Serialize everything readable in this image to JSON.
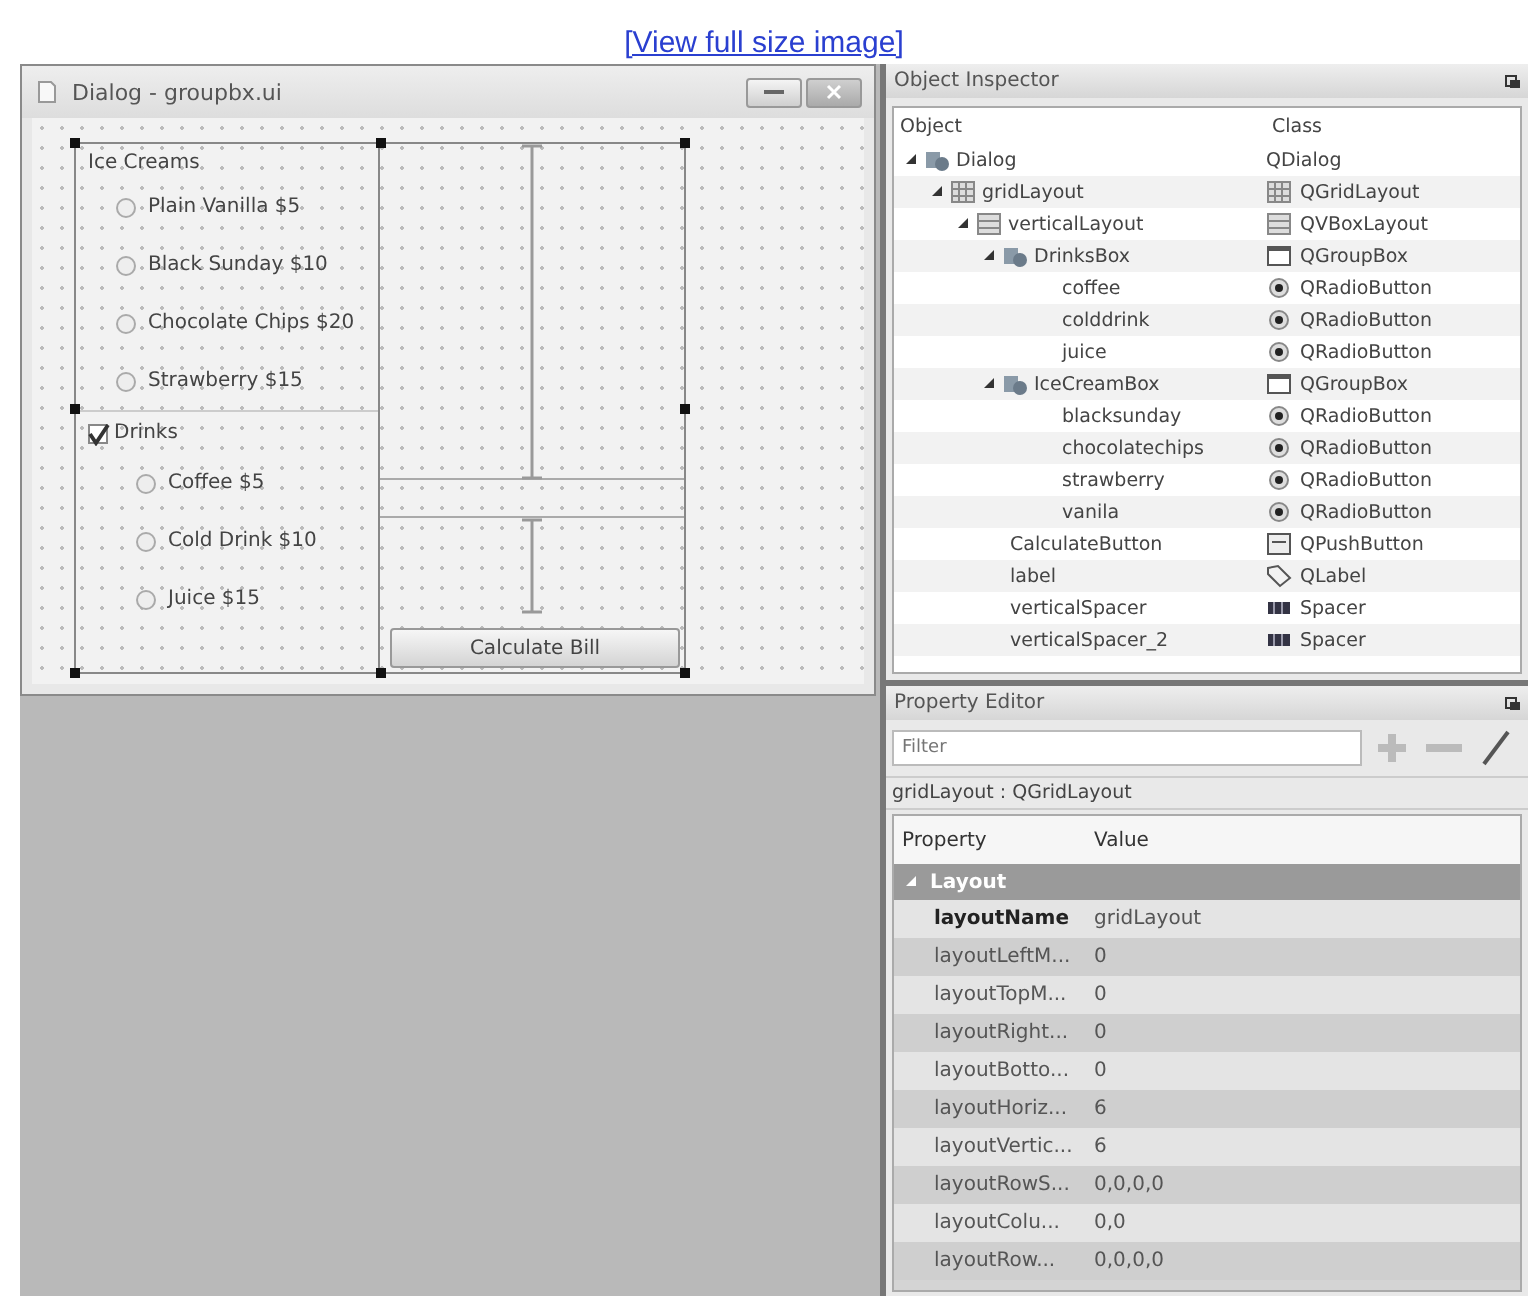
{
  "link": "[View full size image]",
  "form": {
    "title": "Dialog - groupbx.ui",
    "ice_creams": {
      "title": "Ice Creams",
      "options": [
        {
          "label": "Plain Vanilla  $5",
          "selected": false
        },
        {
          "label": "Black Sunday $10",
          "selected": false
        },
        {
          "label": "Chocolate Chips  $20",
          "selected": false
        },
        {
          "label": "Strawberry  $15",
          "selected": false
        }
      ]
    },
    "drinks": {
      "title": "Drinks",
      "checked": true,
      "options": [
        {
          "label": "Coffee  $5",
          "selected": false
        },
        {
          "label": "Cold Drink $10",
          "selected": false
        },
        {
          "label": "Juice $15",
          "selected": false
        }
      ]
    },
    "button": "Calculate Bill"
  },
  "object_inspector": {
    "title": "Object Inspector",
    "columns": [
      "Object",
      "Class"
    ],
    "tree": [
      {
        "object": "Dialog",
        "class": "QDialog",
        "kind": "dialog",
        "expanded": true,
        "children": [
          {
            "object": "gridLayout",
            "class": "QGridLayout",
            "kind": "grid",
            "expanded": true,
            "children": [
              {
                "object": "verticalLayout",
                "class": "QVBoxLayout",
                "kind": "vbox",
                "expanded": true,
                "children": [
                  {
                    "object": "DrinksBox",
                    "class": "QGroupBox",
                    "kind": "groupbox",
                    "expanded": true,
                    "children": [
                      {
                        "object": "coffee",
                        "class": "QRadioButton",
                        "kind": "radio"
                      },
                      {
                        "object": "colddrink",
                        "class": "QRadioButton",
                        "kind": "radio"
                      },
                      {
                        "object": "juice",
                        "class": "QRadioButton",
                        "kind": "radio"
                      }
                    ]
                  },
                  {
                    "object": "IceCreamBox",
                    "class": "QGroupBox",
                    "kind": "groupbox",
                    "expanded": true,
                    "children": [
                      {
                        "object": "blacksunday",
                        "class": "QRadioButton",
                        "kind": "radio"
                      },
                      {
                        "object": "chocolatechips",
                        "class": "QRadioButton",
                        "kind": "radio"
                      },
                      {
                        "object": "strawberry",
                        "class": "QRadioButton",
                        "kind": "radio"
                      },
                      {
                        "object": "vanila",
                        "class": "QRadioButton",
                        "kind": "radio"
                      }
                    ]
                  }
                ]
              },
              {
                "object": "CalculateButton",
                "class": "QPushButton",
                "kind": "button"
              },
              {
                "object": "label",
                "class": "QLabel",
                "kind": "label"
              },
              {
                "object": "verticalSpacer",
                "class": "Spacer",
                "kind": "spacer"
              },
              {
                "object": "verticalSpacer_2",
                "class": "Spacer",
                "kind": "spacer"
              }
            ]
          }
        ]
      }
    ]
  },
  "property_editor": {
    "title": "Property Editor",
    "filter": {
      "placeholder": "Filter"
    },
    "context": "gridLayout : QGridLayout",
    "columns": [
      "Property",
      "Value"
    ],
    "group": {
      "label": "Layout",
      "expanded": true
    },
    "rows": [
      {
        "property": "layoutName",
        "value": "gridLayout",
        "changed": true
      },
      {
        "property": "layoutLeftM...",
        "value": "0",
        "changed": false
      },
      {
        "property": "layoutTopM...",
        "value": "0",
        "changed": false
      },
      {
        "property": "layoutRight...",
        "value": "0",
        "changed": false
      },
      {
        "property": "layoutBotto...",
        "value": "0",
        "changed": false
      },
      {
        "property": "layoutHoriz...",
        "value": "6",
        "changed": false
      },
      {
        "property": "layoutVertic...",
        "value": "6",
        "changed": false
      },
      {
        "property": "layoutRowS...",
        "value": "0,0,0,0",
        "changed": false
      },
      {
        "property": "layoutColu...",
        "value": "0,0",
        "changed": false
      },
      {
        "property": "layoutRow...",
        "value": "0,0,0,0",
        "changed": false
      }
    ]
  }
}
